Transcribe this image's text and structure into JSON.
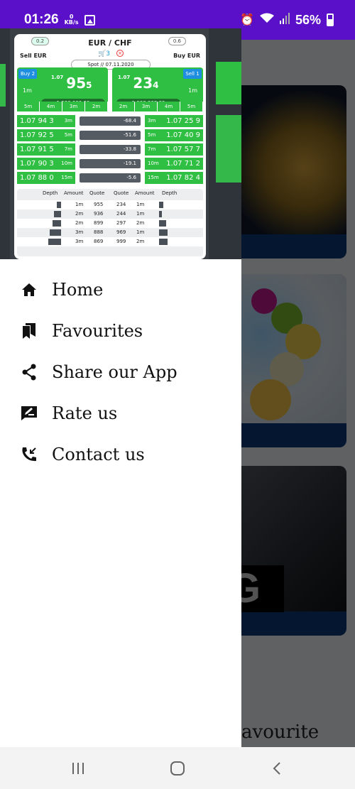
{
  "status_bar": {
    "time": "01:26",
    "kbs_value": "0",
    "kbs_unit": "KB/s",
    "battery": "56%"
  },
  "drawer": {
    "header": {
      "pair": "EUR / CHF",
      "sell_label": "Sell EUR",
      "buy_label": "Buy EUR",
      "left_pill": "0.2",
      "right_pill": "0.6",
      "left_pill_unit": "p",
      "right_pill_unit": "s",
      "cart_count": "3",
      "spot": "Spot  //  07.11.2020",
      "buy_tag": "Buy 2",
      "sell_tag": "Sell 1",
      "buy_small": "1.07",
      "buy_main": "95",
      "buy_sub": "5",
      "sell_small": "1.07",
      "sell_main": "23",
      "sell_sub": "4",
      "tenor": "1m",
      "amount": "1,000,000.00",
      "tenors": [
        "5m",
        "4m",
        "3m",
        "2m"
      ],
      "tenors_right": [
        "2m",
        "3m",
        "4m",
        "5m"
      ],
      "ladder": [
        {
          "left": "1.07 94 3",
          "left_tenor": "3m",
          "mid": "-68.4",
          "right_tenor": "3m",
          "right": "1.07 25 9"
        },
        {
          "left": "1.07 92 5",
          "left_tenor": "5m",
          "mid": "-51.6",
          "right_tenor": "5m",
          "right": "1.07 40 9"
        },
        {
          "left": "1.07 91 5",
          "left_tenor": "7m",
          "mid": "-33.8",
          "right_tenor": "7m",
          "right": "1.07 57 7"
        },
        {
          "left": "1.07 90 3",
          "left_tenor": "10m",
          "mid": "-19.1",
          "right_tenor": "10m",
          "right": "1.07 71 2"
        },
        {
          "left": "1.07 88 0",
          "left_tenor": "15m",
          "mid": "-5.6",
          "right_tenor": "15m",
          "right": "1.07 82 4"
        }
      ],
      "depth_headers": [
        "Depth",
        "Amount",
        "Quote",
        "Quote",
        "Amount",
        "Depth"
      ],
      "depth_rows": [
        {
          "bid_amount": "1m",
          "bid_quote": "955",
          "ask_quote": "234",
          "ask_amount": "1m"
        },
        {
          "bid_amount": "2m",
          "bid_quote": "936",
          "ask_quote": "244",
          "ask_amount": "1m"
        },
        {
          "bid_amount": "2m",
          "bid_quote": "899",
          "ask_quote": "297",
          "ask_amount": "2m"
        },
        {
          "bid_amount": "3m",
          "bid_quote": "888",
          "ask_quote": "969",
          "ask_amount": "1m"
        },
        {
          "bid_amount": "3m",
          "bid_quote": "869",
          "ask_quote": "999",
          "ask_amount": "2m"
        }
      ]
    },
    "menu": [
      {
        "label": "Home",
        "icon": "home-icon"
      },
      {
        "label": "Favourites",
        "icon": "bookmarks-icon"
      },
      {
        "label": "Share our App",
        "icon": "share-icon"
      },
      {
        "label": "Rate us",
        "icon": "rate-icon"
      },
      {
        "label": "Contact us",
        "icon": "phone-callback-icon"
      }
    ]
  },
  "background": {
    "partial_title": "avourite"
  },
  "colors": {
    "status_bar": "#5a0fc8",
    "buy_green": "#2fbf43",
    "card_bar": "#0e3a78"
  }
}
